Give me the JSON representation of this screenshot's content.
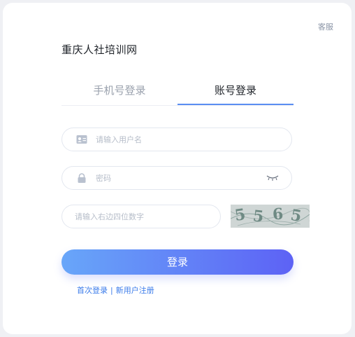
{
  "header": {
    "service_label": "客服",
    "site_title": "重庆人社培训网"
  },
  "tabs": [
    {
      "label": "手机号登录",
      "active": false
    },
    {
      "label": "账号登录",
      "active": true
    }
  ],
  "form": {
    "username": {
      "value": "",
      "placeholder": "请输入用户名",
      "icon": "id-card-icon"
    },
    "password": {
      "value": "",
      "placeholder": "密码",
      "icon": "lock-icon",
      "toggle_icon": "eye-closed-icon"
    },
    "captcha": {
      "value": "",
      "placeholder": "请输入右边四位数字",
      "image_code": [
        "5",
        "5",
        "6",
        "5"
      ]
    }
  },
  "submit_label": "登录",
  "links": {
    "first_login": "首次登录",
    "separator": "|",
    "register": "新用户注册"
  },
  "colors": {
    "accent": "#5b8ef2",
    "button_start": "#68a6f9",
    "button_end": "#5d62f5",
    "link": "#3a7bea"
  }
}
